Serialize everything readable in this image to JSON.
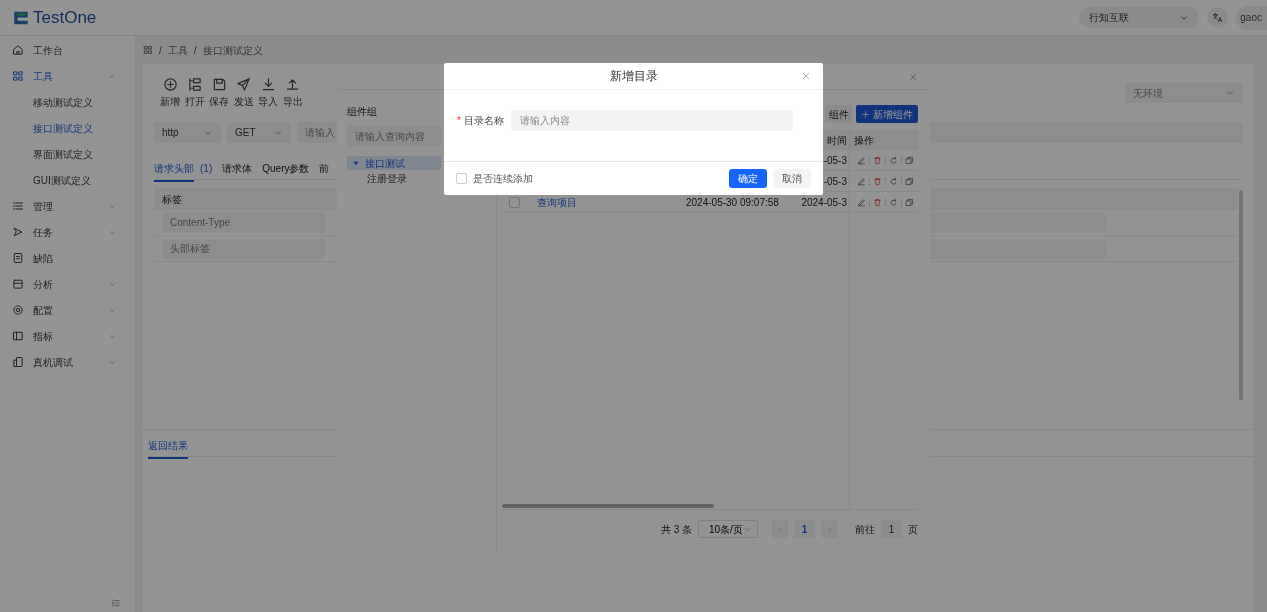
{
  "header": {
    "logo": "TestOne",
    "org_select": "行知互联",
    "user": "gaoc"
  },
  "sidebar": {
    "items": [
      {
        "label": "工作台",
        "kind": "link",
        "selected": false
      },
      {
        "label": "工具",
        "kind": "group",
        "selected": true,
        "expanded": true,
        "children": [
          {
            "label": "移动测试定义",
            "selected": false
          },
          {
            "label": "接口测试定义",
            "selected": true
          },
          {
            "label": "界面测试定义",
            "selected": false
          },
          {
            "label": "GUI测试定义",
            "selected": false
          }
        ]
      },
      {
        "label": "管理",
        "kind": "group",
        "selected": false,
        "expanded": false
      },
      {
        "label": "任务",
        "kind": "group",
        "selected": false,
        "expanded": false
      },
      {
        "label": "缺陷",
        "kind": "link",
        "selected": false
      },
      {
        "label": "分析",
        "kind": "group",
        "selected": false,
        "expanded": false
      },
      {
        "label": "配置",
        "kind": "group",
        "selected": false,
        "expanded": false
      },
      {
        "label": "指标",
        "kind": "group",
        "selected": false,
        "expanded": false
      },
      {
        "label": "真机调试",
        "kind": "group",
        "selected": false,
        "expanded": false
      }
    ]
  },
  "breadcrumb": [
    {
      "kind": "home"
    },
    {
      "kind": "separator",
      "text": "/"
    },
    {
      "kind": "crumb",
      "text": "工具"
    },
    {
      "kind": "separator",
      "text": "/"
    },
    {
      "kind": "crumb",
      "text": "接口测试定义"
    }
  ],
  "toolbar": [
    {
      "label": "新增"
    },
    {
      "label": "打开"
    },
    {
      "label": "保存"
    },
    {
      "label": "发送"
    },
    {
      "label": "导入"
    },
    {
      "label": "导出"
    }
  ],
  "environment": {
    "value": "无环境"
  },
  "request": {
    "protocol": "http",
    "method": "GET",
    "url_placeholder": "请输入"
  },
  "tabs": [
    {
      "label": "请求头部",
      "count": "(1)",
      "selected": true
    },
    {
      "label": "请求体",
      "selected": false
    },
    {
      "label": "Query参数",
      "selected": false
    },
    {
      "label": "前",
      "selected": false
    }
  ],
  "headers_table": {
    "columns": [
      "标签"
    ],
    "rows": [
      {
        "placeholder": "Content-Type"
      },
      {
        "placeholder": "头部标签"
      }
    ]
  },
  "result_tabs": [
    {
      "label": "返回结果",
      "selected": true
    }
  ],
  "component_picker": {
    "group_title": "组件组",
    "search_placeholder": "请输入查询内容",
    "tree": [
      {
        "label": "接口测试",
        "expanded": true,
        "selected": true,
        "children": [
          {
            "label": "注册登录",
            "selected": false
          }
        ]
      }
    ],
    "buttons": [
      {
        "label": "组件",
        "kind": "secondary"
      },
      {
        "label": "新增组件",
        "kind": "primary"
      }
    ],
    "table": {
      "columns": [
        {
          "label": "时间"
        },
        {
          "label": "操作"
        }
      ],
      "rows": [
        {
          "updated": "-05-3"
        },
        {
          "updated": "-05-3"
        },
        {
          "checked": false,
          "name": "查询项目",
          "created": "2024-05-30 09:07:58",
          "updated": "2024-05-3"
        }
      ]
    },
    "pagination": {
      "total": "共 3 条",
      "page_size": "10条/页",
      "pages": [
        {
          "label": "1",
          "selected": true
        }
      ],
      "goto_label": "前往",
      "goto_value": "1",
      "goto_suffix": "页"
    }
  },
  "dialog": {
    "title": "新增目录",
    "field": {
      "required_mark": "*",
      "label": "目录名称",
      "placeholder": "请输入内容"
    },
    "continue_add": {
      "label": "是否连续添加",
      "checked": false
    },
    "buttons": [
      {
        "label": "确定",
        "kind": "primary"
      },
      {
        "label": "取消",
        "kind": "secondary"
      }
    ]
  }
}
